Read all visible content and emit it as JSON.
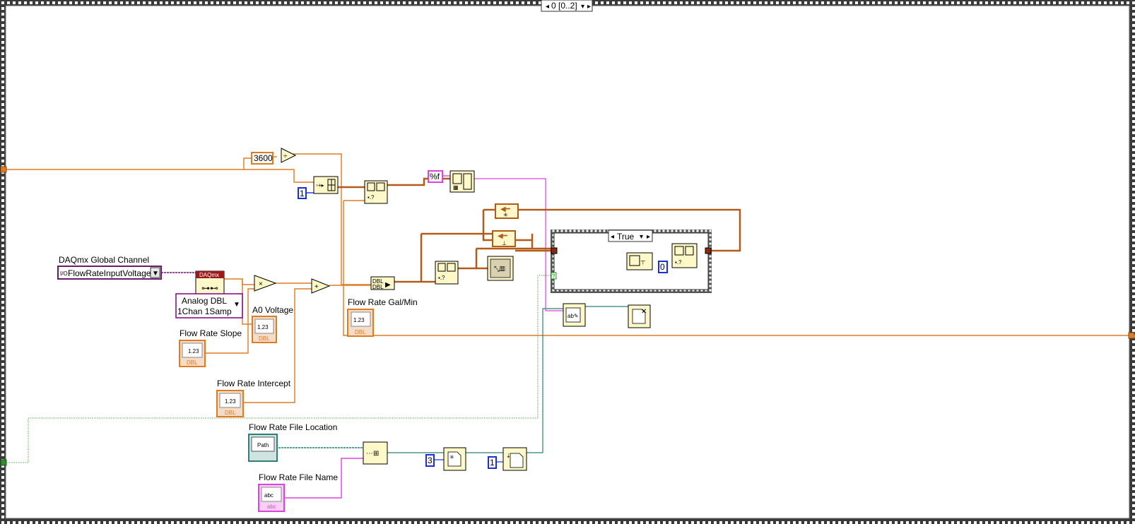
{
  "sequence": {
    "frame_selector": "0 [0..2]"
  },
  "case_structure": {
    "selector": "True"
  },
  "constants": {
    "seconds_per_hour": "3600",
    "format_string": "%f",
    "index_one": "1",
    "index_zero": "0",
    "open_mode": "3",
    "write_mode": "1"
  },
  "labels": {
    "daqmx_channel": "DAQmx Global Channel",
    "channel_value": "FlowRateInputVoltage",
    "channel_prefix": "I/O",
    "daqmx_read_mode_line1": "Analog DBL",
    "daqmx_read_mode_line2": "1Chan 1Samp",
    "a0_voltage": "A0 Voltage",
    "flow_rate_slope": "Flow Rate Slope",
    "flow_rate_intercept": "Flow Rate Intercept",
    "flow_rate_gal_min": "Flow Rate Gal/Min",
    "flow_rate_file_location": "Flow Rate File Location",
    "flow_rate_file_name": "Flow Rate File Name"
  },
  "terminal_text": {
    "numeric": "1.23",
    "dbl": "DBL",
    "path": "Path",
    "string": "abc",
    "daqmx": "DAQmx"
  },
  "colors": {
    "frame_border": "#3a3a3a",
    "wire_orange": "#e07b22",
    "wire_brown": "#b35a1a",
    "wire_pink": "#e040e0",
    "wire_teal": "#2c7f7a",
    "wire_green": "#2e8b2e",
    "wire_blue": "#1b2fd6",
    "node_fill": "#fff8c8"
  }
}
